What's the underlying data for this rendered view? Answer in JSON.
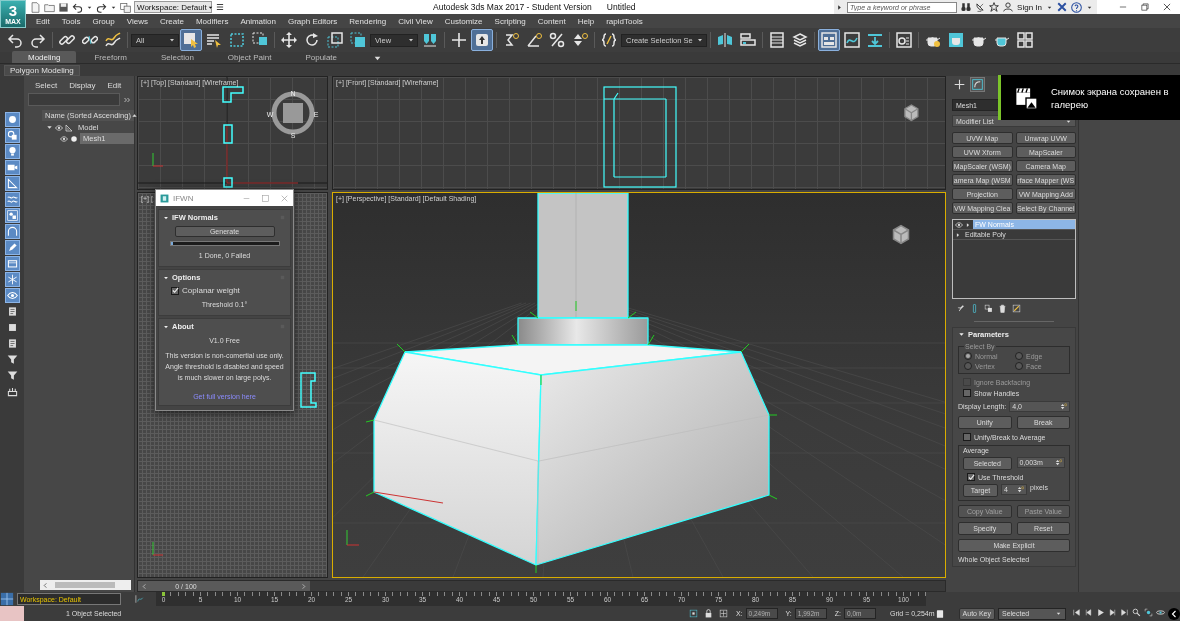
{
  "title_bar": {
    "app_logo": "3",
    "app_logo_sub": "MAX",
    "workspace": "Workspace: Default",
    "title": "Autodesk 3ds Max 2017 - Student Version",
    "document": "Untitled",
    "search": {
      "placeholder": "Type a keyword or phrase"
    },
    "sign_in": "Sign In"
  },
  "menu": [
    "Edit",
    "Tools",
    "Group",
    "Views",
    "Create",
    "Modifiers",
    "Animation",
    "Graph Editors",
    "Rendering",
    "Civil View",
    "Customize",
    "Scripting",
    "Content",
    "Help",
    "rapidTools"
  ],
  "main_toolbar": [
    [
      {
        "kind": "undo",
        "selected": false
      },
      {
        "kind": "redo",
        "selected": false
      }
    ],
    [
      {
        "kind": "link",
        "selected": false
      },
      {
        "kind": "unlink",
        "selected": false
      },
      {
        "kind": "bind",
        "selected": false
      }
    ],
    [
      {
        "kind": "dropdown",
        "value": "All"
      },
      {
        "kind": "select",
        "selected": true
      },
      {
        "kind": "select_name",
        "selected": false
      },
      {
        "kind": "region",
        "selected": false
      },
      {
        "kind": "crossing",
        "selected": false
      }
    ],
    [
      {
        "kind": "move",
        "selected": false
      },
      {
        "kind": "rotate",
        "selected": false
      },
      {
        "kind": "scale",
        "selected": false
      },
      {
        "kind": "pivot",
        "selected": false
      },
      {
        "kind": "dropdown",
        "value": "View"
      },
      {
        "kind": "placement",
        "selected": false
      }
    ],
    [
      {
        "kind": "crosshair",
        "selected": false
      },
      {
        "kind": "keyboard",
        "selected": true
      }
    ],
    [
      {
        "kind": "snap",
        "selected": false
      },
      {
        "kind": "angle",
        "selected": false
      },
      {
        "kind": "percent",
        "selected": false
      },
      {
        "kind": "spinner",
        "selected": false
      }
    ],
    [
      {
        "kind": "braces",
        "selected": false
      },
      {
        "kind": "dropdown",
        "value": "Create Selection Se"
      }
    ],
    [
      {
        "kind": "mirror",
        "selected": false
      },
      {
        "kind": "align",
        "selected": false
      }
    ],
    [
      {
        "kind": "table",
        "selected": false
      },
      {
        "kind": "layers",
        "selected": false
      }
    ],
    [
      {
        "kind": "panels",
        "selected": true
      },
      {
        "kind": "curve",
        "selected": false
      },
      {
        "kind": "download",
        "selected": false
      }
    ],
    [
      {
        "kind": "material",
        "selected": false
      }
    ],
    [
      {
        "kind": "teapot_gear",
        "selected": false
      },
      {
        "kind": "teapot_window",
        "selected": false
      },
      {
        "kind": "teapot",
        "selected": false
      },
      {
        "kind": "teapot_cyan",
        "selected": false
      },
      {
        "kind": "grid4",
        "selected": false
      }
    ]
  ],
  "ribbon": {
    "tabs": [
      {
        "label": "Modeling",
        "selected": true
      },
      {
        "label": "Freeform",
        "selected": false
      },
      {
        "label": "Selection",
        "selected": false
      },
      {
        "label": "Object Paint",
        "selected": false
      },
      {
        "label": "Populate",
        "selected": false
      }
    ],
    "panel": "Polygon Modeling"
  },
  "left_strip": [
    {
      "kind": "circle",
      "on": true
    },
    {
      "kind": "shapes",
      "on": true
    },
    {
      "kind": "bulb",
      "on": true
    },
    {
      "kind": "camera",
      "on": true
    },
    {
      "kind": "ruler",
      "on": true
    },
    {
      "kind": "waves",
      "on": true
    },
    {
      "kind": "group",
      "on": true
    },
    {
      "kind": "arch",
      "on": true
    },
    {
      "kind": "pen",
      "on": true
    },
    {
      "kind": "container",
      "on": true
    },
    {
      "kind": "snowflake",
      "on": true
    },
    {
      "kind": "eye",
      "on": true
    },
    {
      "kind": "doc",
      "on": false
    },
    {
      "kind": "square",
      "on": false
    },
    {
      "kind": "doc",
      "on": false
    },
    {
      "kind": "funnel",
      "on": false
    },
    {
      "kind": "funnel",
      "on": false
    },
    {
      "kind": "tray",
      "on": false
    }
  ],
  "scene_explorer": {
    "menu": [
      "Select",
      "Display",
      "Edit"
    ],
    "column": "Name (Sorted Ascending)",
    "tree": [
      {
        "kind": "layer",
        "label": "Model",
        "expanded": true,
        "selected": false,
        "children": [
          {
            "kind": "mesh",
            "label": "Mesh1",
            "selected": true
          }
        ]
      }
    ]
  },
  "viewports": [
    {
      "kind": "top",
      "label": "[+] [Top] [Standard] [Wireframe]",
      "active": false,
      "compass": [
        "N",
        "E",
        "S",
        "W"
      ]
    },
    {
      "kind": "front",
      "label": "[+] [Front] [Standard] [Wireframe]",
      "active": false
    },
    {
      "kind": "left",
      "label": "[+] [",
      "active": false
    },
    {
      "kind": "perspective",
      "label": "[+] [Perspective] [Standard] [Default Shading]",
      "active": true
    }
  ],
  "time_slider": {
    "label": "0 / 100",
    "level": 0
  },
  "dialog": {
    "title": "IFWN",
    "rollouts": [
      {
        "kind": "generate",
        "title": "IFW Normals",
        "expanded": true,
        "button": "Generate",
        "progress": {
          "level": 0.02
        },
        "status": "1 Done, 0 Failed"
      },
      {
        "kind": "options",
        "title": "Options",
        "expanded": true,
        "checkbox": {
          "label": "Coplanar weight",
          "checked": true
        },
        "threshold": "Threshold 0.1°"
      },
      {
        "kind": "about",
        "title": "About",
        "expanded": true,
        "version": "V1.0 Free",
        "text": "This version is non-comertial use only. Angle threshold is disabled and speed is much slower on large polys.",
        "link": "Get full version here"
      }
    ]
  },
  "command_panel": {
    "tabs": [
      {
        "kind": "create",
        "selected": false
      },
      {
        "kind": "modify",
        "selected": true
      }
    ],
    "object_name": "Mesh1",
    "modifier_list": "Modifier List",
    "modifier_buttons": [
      "UVW Map",
      "Unwrap UVW",
      "UVW Xform",
      "MapScaler",
      "MapScaler (WSM)",
      "Camera Map",
      "amera Map (WSM",
      "rface Mapper (WS",
      "Projection",
      "VW Mapping Add",
      "VW Mapping Clea",
      "Select By Channel"
    ],
    "stack": [
      {
        "kind": "modifier",
        "label": "FW Normals",
        "selected": true
      },
      {
        "kind": "base",
        "label": "Editable Poly",
        "selected": false
      }
    ],
    "parameters": {
      "title": "Parameters",
      "expanded": true,
      "select_by": {
        "title": "Select By",
        "disabled": true,
        "options": [
          {
            "label": "Normal",
            "selected": true
          },
          {
            "label": "Edge",
            "selected": false
          },
          {
            "label": "Vertex",
            "selected": false
          },
          {
            "label": "Face",
            "selected": false
          }
        ]
      },
      "ignore_backfacing": {
        "label": "Ignore Backfacing",
        "checked": false,
        "disabled": true
      },
      "show_handles": {
        "label": "Show Handles",
        "checked": false,
        "disabled": false
      },
      "display_length": {
        "label": "Display Length:",
        "value": "4,0"
      },
      "unify": "Unify",
      "break": "Break",
      "unify_to_average": {
        "label": "Unify/Break to Average",
        "checked": false,
        "disabled": false
      },
      "average": {
        "title": "Average",
        "selected_button": "Selected",
        "selected_value": "0,003m",
        "use_threshold": {
          "label": "Use Threshold",
          "checked": true,
          "disabled": false
        },
        "target_button": "Target",
        "target_value": "4",
        "units": "pixels"
      },
      "copy_value": {
        "label": "Copy Value",
        "disabled": true
      },
      "paste_value": {
        "label": "Paste Value",
        "disabled": true
      },
      "specify": "Specify",
      "reset": "Reset",
      "make_explicit": "Make Explicit",
      "status": "Whole Object Selected"
    }
  },
  "toast": {
    "text": "Снимок экрана сохранен в галерею"
  },
  "bottom": {
    "workspace": "Workspace: Default",
    "ruler": [
      "0",
      "5",
      "10",
      "15",
      "20",
      "25",
      "30",
      "35",
      "40",
      "45",
      "50",
      "55",
      "60",
      "65",
      "70",
      "75",
      "80",
      "85",
      "90",
      "95",
      "100"
    ],
    "status": "1 Object Selected",
    "coords": [
      {
        "axis": "X:",
        "value": "0,249m"
      },
      {
        "axis": "Y:",
        "value": "1,992m"
      },
      {
        "axis": "Z:",
        "value": "0,0m"
      }
    ],
    "grid": "Grid = 0,254m",
    "auto_key": {
      "label": "Auto Key",
      "on": false
    },
    "key_filter": "Selected"
  }
}
